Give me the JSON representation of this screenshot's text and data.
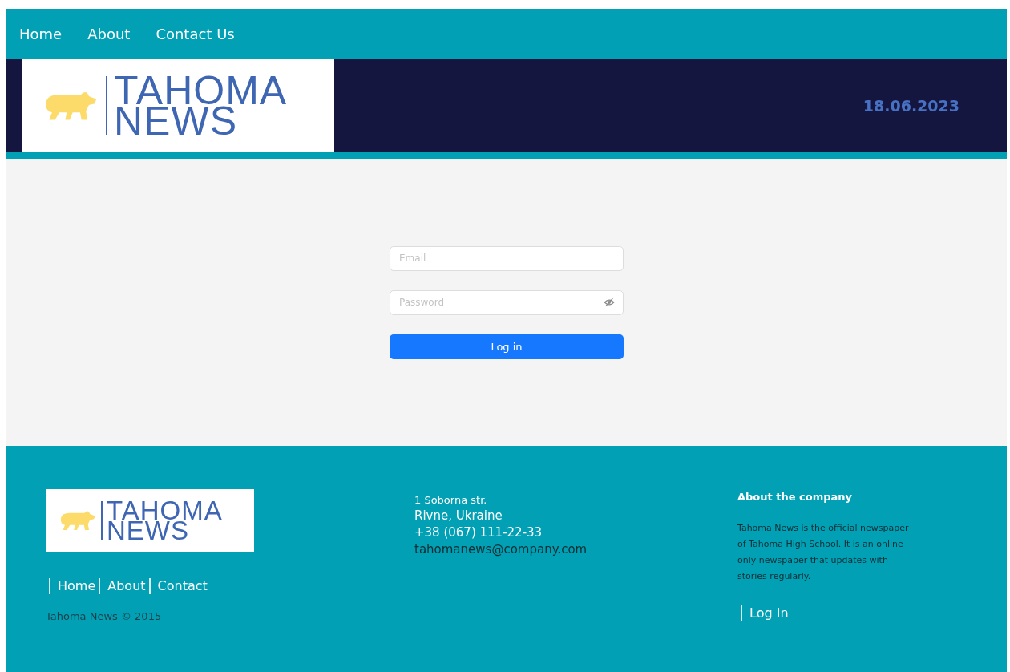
{
  "nav": {
    "links": [
      "Home",
      "About",
      "Contact Us"
    ]
  },
  "header": {
    "logo": {
      "line_1": "TAHOMA",
      "line_2": "NEWS"
    },
    "date": "18.06.2023"
  },
  "login_form": {
    "email": {
      "placeholder": "Email"
    },
    "password": {
      "placeholder": "Password"
    },
    "button": "Log in"
  },
  "footer": {
    "logo": {
      "line_1": "TAHOMA",
      "line_2": "NEWS"
    },
    "links": [
      "Home",
      "About",
      "Contact"
    ],
    "copyright": "Tahoma News © 2015",
    "address": {
      "street": "1 Soborna str.",
      "city": "Rivne, Ukraine",
      "phone": "+38 (067) 111-22-33",
      "email": "tahomanews@company.com"
    },
    "about": {
      "title": "About the company",
      "text": "Tahoma News is the official newspaper of Tahoma High School. It is an online only newspaper that updates with stories regularly.",
      "link": "Log In"
    }
  }
}
